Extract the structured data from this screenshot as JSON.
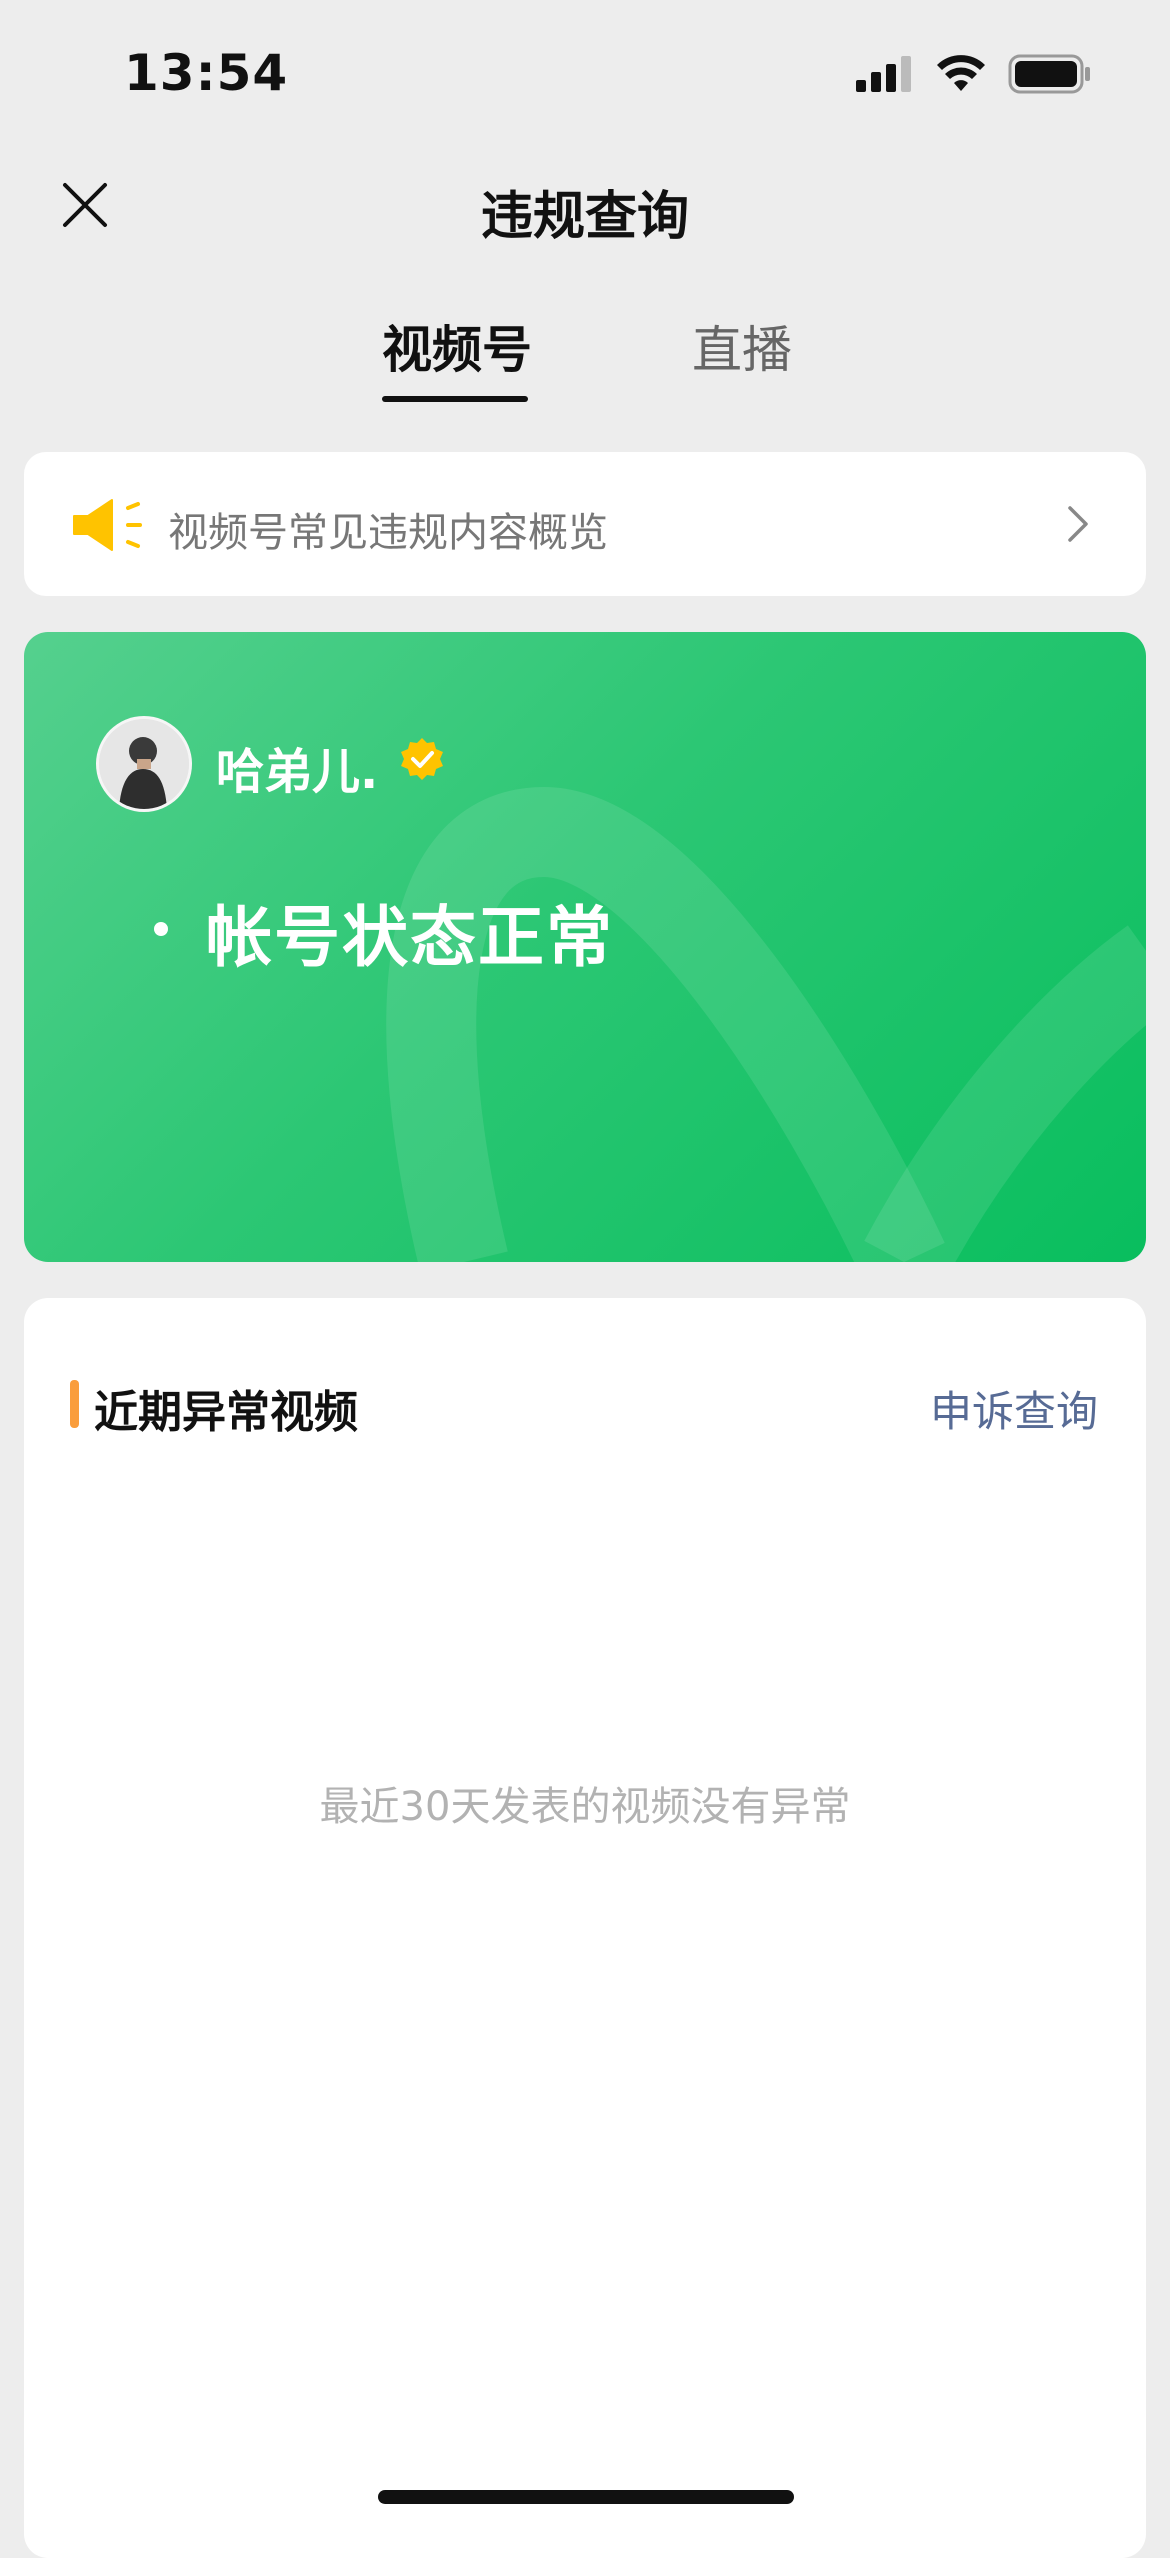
{
  "status_bar": {
    "time": "13:54",
    "icons": [
      "cellular-signal-icon",
      "wifi-icon",
      "battery-icon"
    ]
  },
  "nav": {
    "title": "违规查询",
    "close_icon": "close-icon"
  },
  "tabs": [
    {
      "label": "视频号",
      "active": true
    },
    {
      "label": "直播",
      "active": false
    }
  ],
  "notice": {
    "icon": "megaphone-icon",
    "text": "视频号常见违规内容概览",
    "chevron": "chevron-right-icon"
  },
  "account_card": {
    "username": "哈弟儿.",
    "verified_icon": "verified-badge-icon",
    "status": "帐号状态正常"
  },
  "recent_section": {
    "title": "近期异常视频",
    "appeal_link": "申诉查询",
    "empty_message": "最近30天发表的视频没有异常"
  },
  "colors": {
    "background": "#EDEDED",
    "card_green": "#2CC774",
    "accent_orange": "#FA9D3B",
    "link_blue": "#576B95",
    "megaphone_yellow": "#FFC300",
    "verified_yellow": "#FFC300"
  }
}
